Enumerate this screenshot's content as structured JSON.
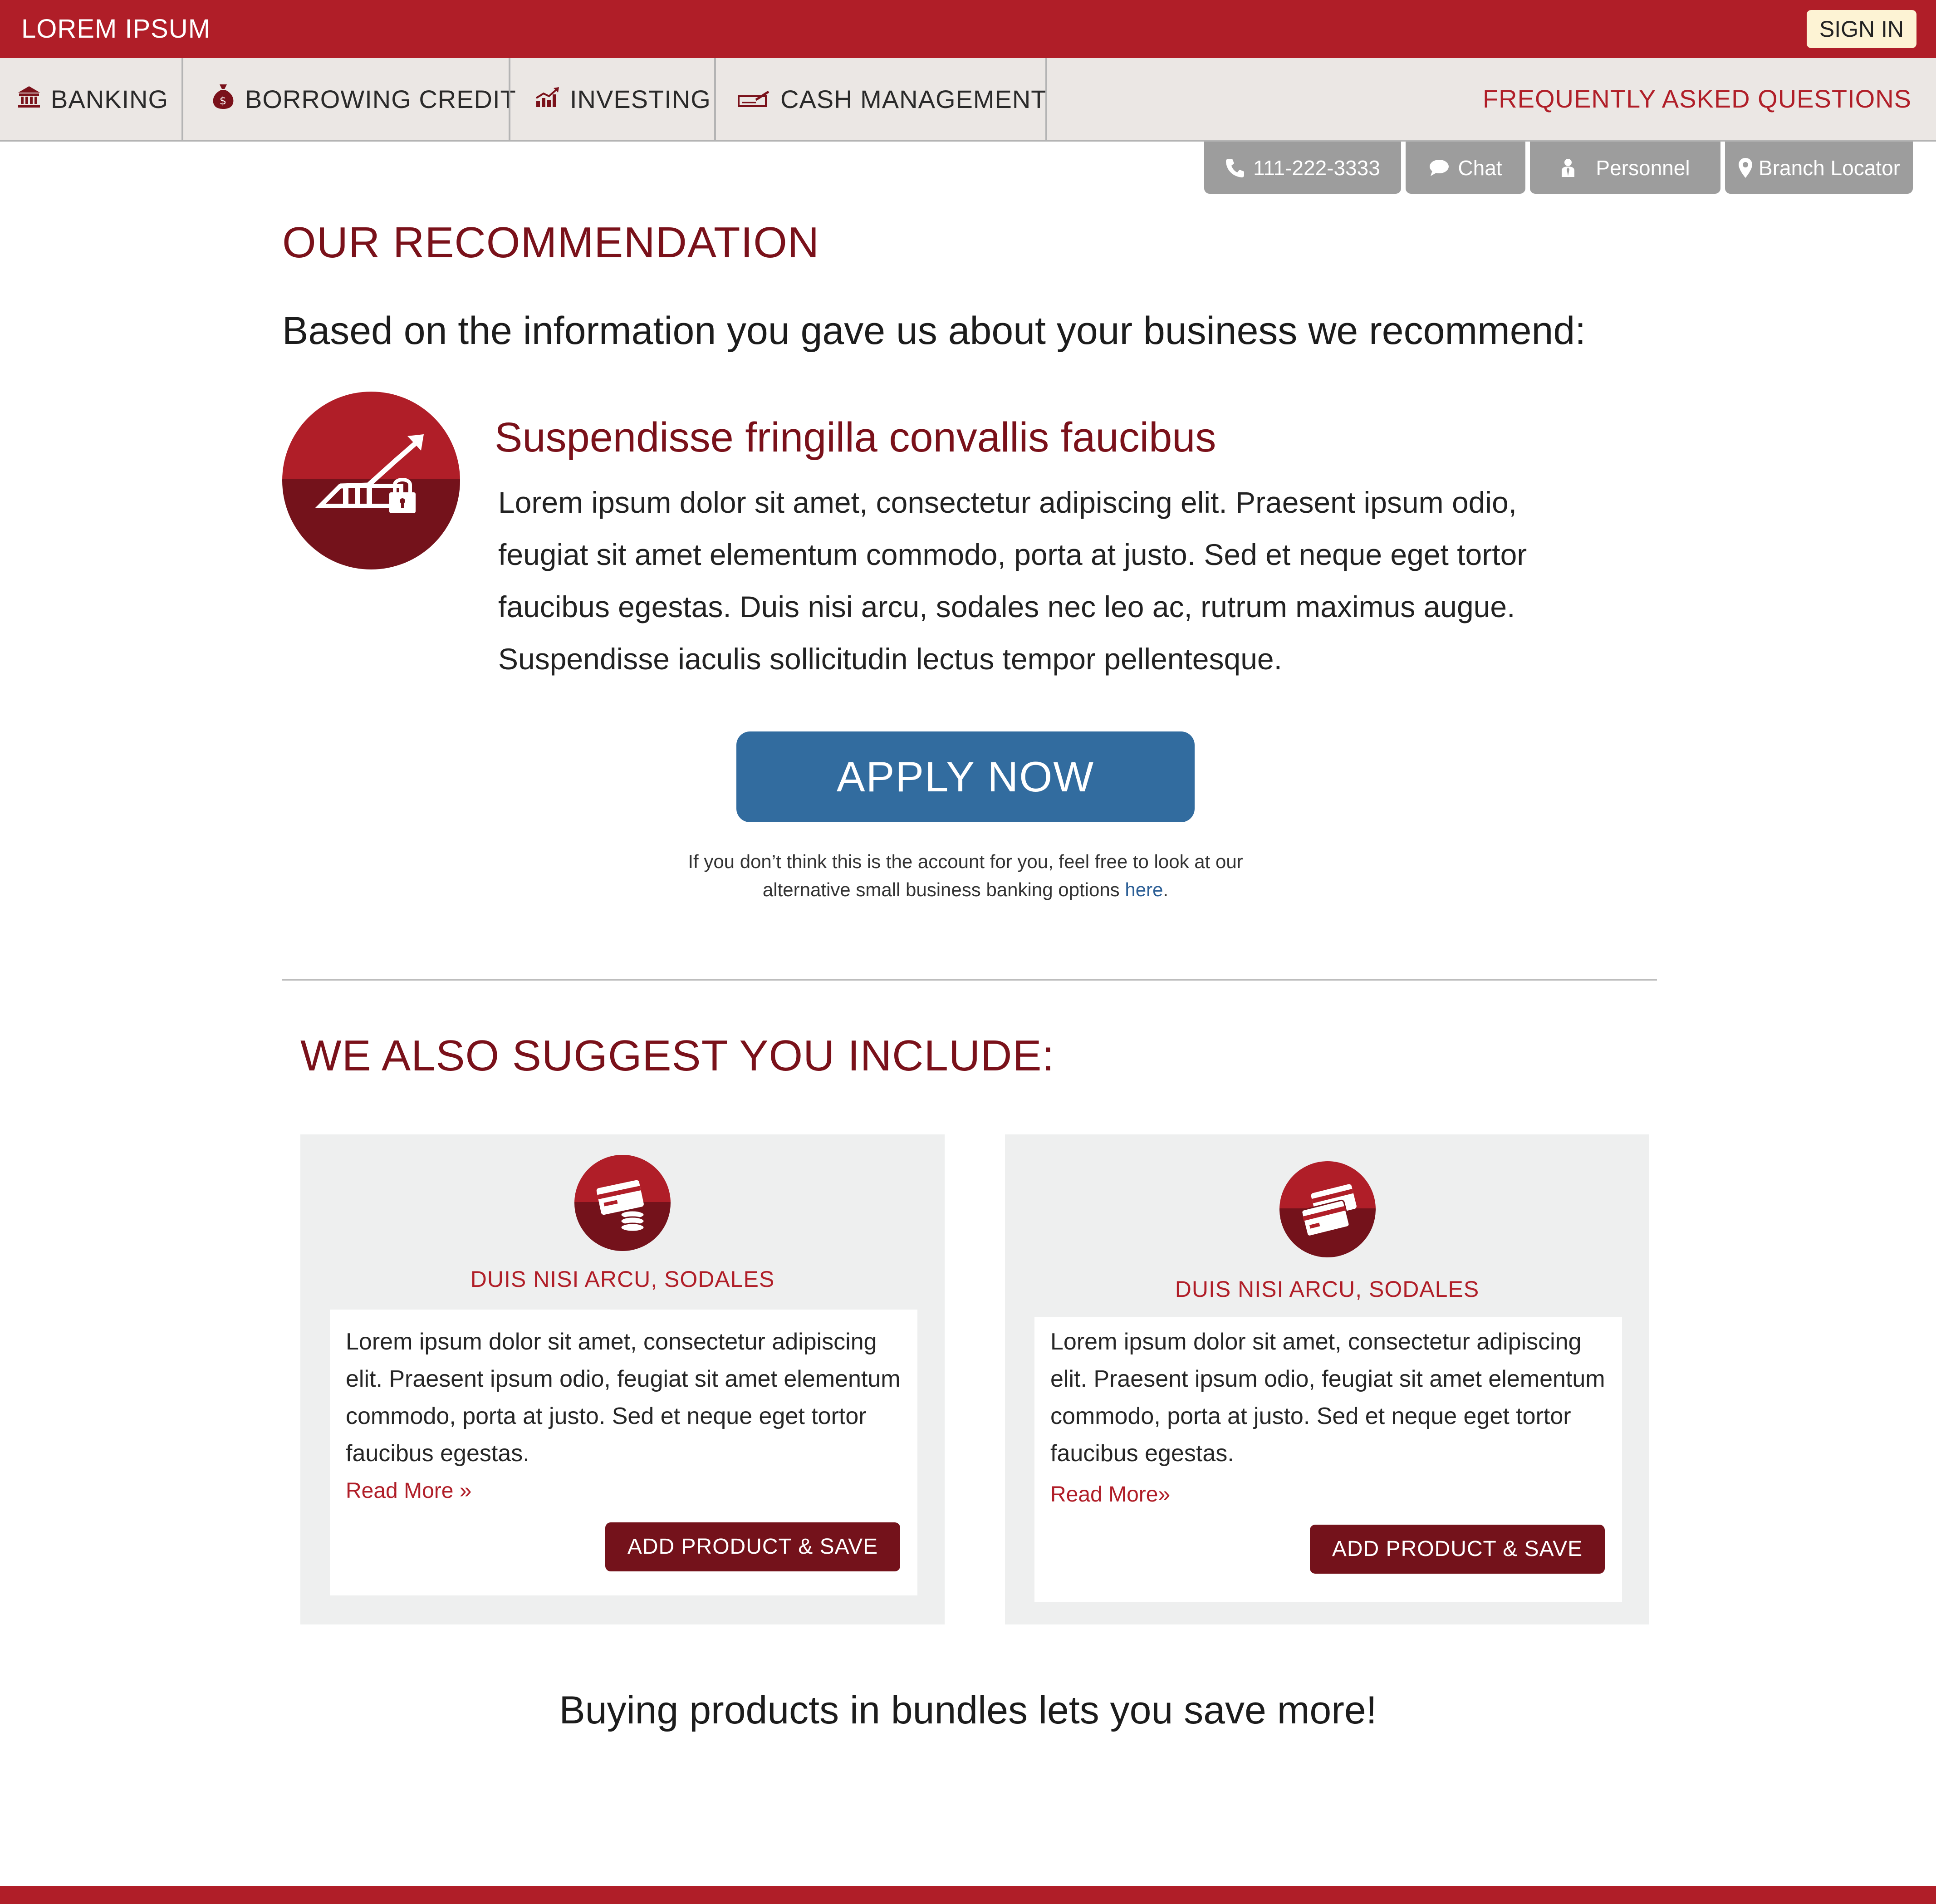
{
  "header": {
    "brand": "LOREM IPSUM",
    "sign_in": "SIGN IN"
  },
  "nav": {
    "items": [
      {
        "label": "BANKING",
        "icon": "bank-icon"
      },
      {
        "label": "BORROWING CREDIT",
        "icon": "money-bag-icon"
      },
      {
        "label": "INVESTING",
        "icon": "chart-growth-icon"
      },
      {
        "label": "CASH MANAGEMENT",
        "icon": "check-pen-icon"
      }
    ],
    "faq": "FREQUENTLY ASKED QUESTIONS"
  },
  "utility": {
    "phone": "111-222-3333",
    "chat": "Chat",
    "personnel": "Personnel",
    "branch": "Branch Locator"
  },
  "recommendation": {
    "heading": "OUR RECOMMENDATION",
    "intro": "Based on the information you gave us about your business we recommend:",
    "product_title": "Suspendisse fringilla convallis faucibus",
    "product_body": "Lorem ipsum dolor sit amet, consectetur adipiscing elit. Praesent ipsum odio, feugiat sit amet elementum commodo, porta at justo. Sed et neque eget tortor faucibus egestas. Duis nisi arcu, sodales nec leo ac, rutrum maximus augue. Suspendisse iaculis sollicitudin lectus tempor pellentesque.",
    "icon": "secure-growth-icon",
    "apply": "APPLY NOW",
    "note_line1": "If you don’t think this is the account for you, feel free to look at our",
    "note_line2": "alternative small business banking options",
    "note_link": "here",
    "note_end": "."
  },
  "suggestions": {
    "heading": "WE ALSO SUGGEST YOU INCLUDE:",
    "cards": [
      {
        "title": "DUIS NISI ARCU, SODALES",
        "body": "Lorem ipsum dolor sit amet, consectetur adipiscing elit. Praesent ipsum odio, feugiat sit amet elementum commodo, porta at justo. Sed et neque eget tortor faucibus egestas.",
        "read_more": "Read More »",
        "button": "ADD PRODUCT & SAVE",
        "icon": "card-coins-icon"
      },
      {
        "title": "DUIS NISI ARCU, SODALES",
        "body": "Lorem ipsum dolor sit amet, consectetur adipiscing elit. Praesent ipsum odio, feugiat sit amet elementum commodo, porta at justo. Sed et neque eget tortor faucibus egestas.",
        "read_more": "Read More»",
        "button": "ADD PRODUCT & SAVE",
        "icon": "credit-cards-icon"
      }
    ]
  },
  "bundle_message": "Buying products in bundles lets you save more!",
  "colors": {
    "brand_red": "#b01e28",
    "dark_red": "#74121b",
    "apply_blue": "#326c9f",
    "nav_gray": "#ebe7e4",
    "tab_gray": "#9d9d9d"
  }
}
